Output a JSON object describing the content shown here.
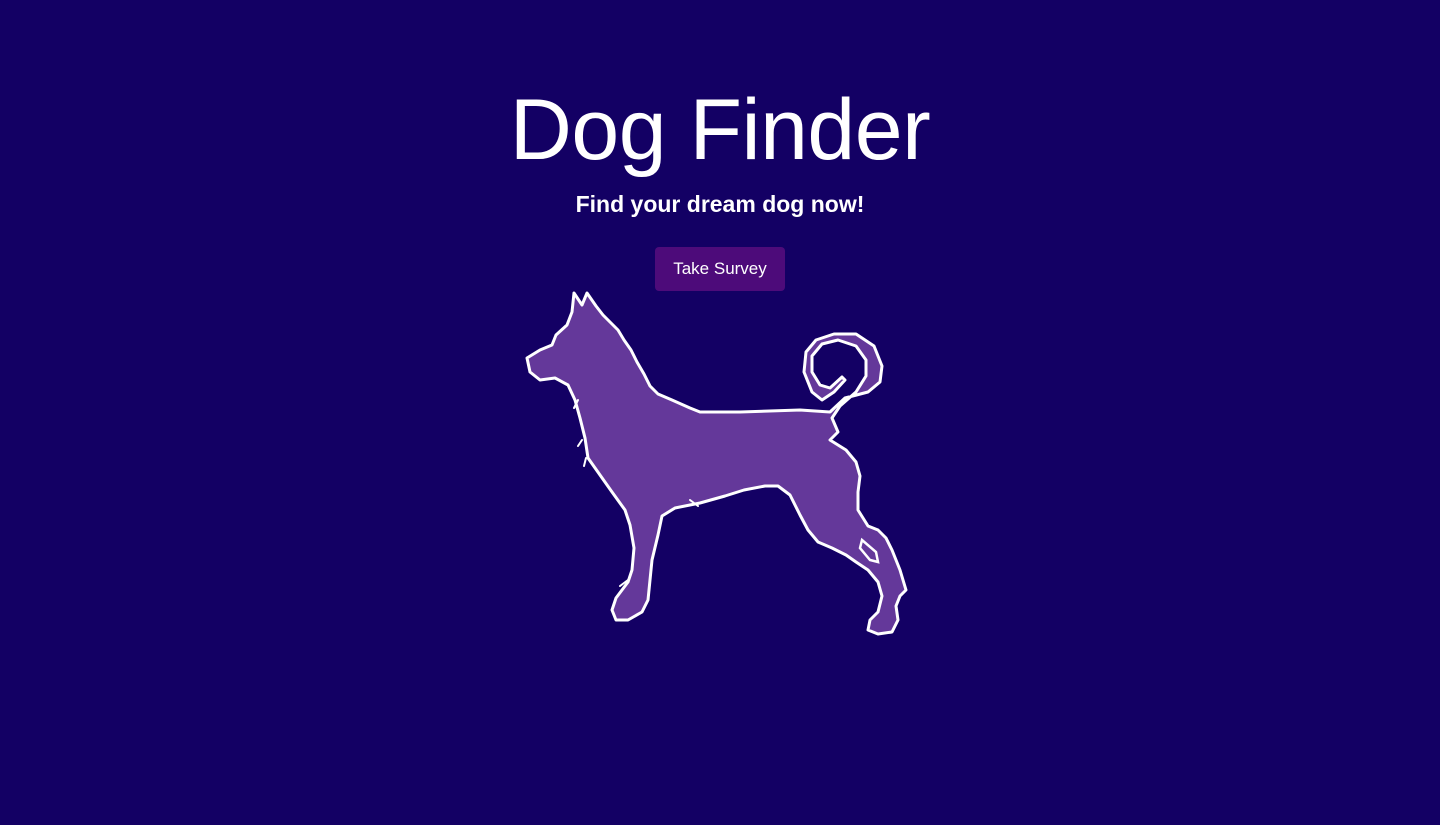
{
  "header": {
    "title": "Dog Finder",
    "subtitle": "Find your dream dog now!"
  },
  "actions": {
    "survey_label": "Take Survey"
  },
  "illustration": {
    "icon": "dog-silhouette-icon",
    "fill_color": "#64389a",
    "outline_color": "#ffffff"
  },
  "colors": {
    "background": "#130064",
    "button": "#4d0b7a",
    "text": "#ffffff"
  }
}
